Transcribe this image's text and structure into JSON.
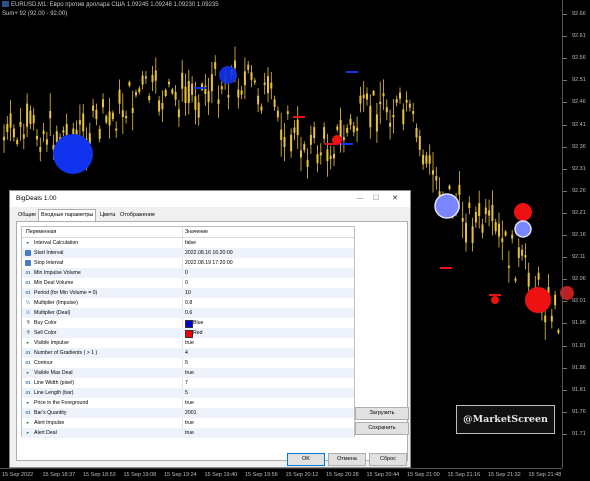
{
  "chart": {
    "header_line1": "EURUSD,M1: Евро против доллара США  1.09245 1.09248 1.09230 1.09235",
    "header_line2": "Sum+ 92 (92.00 - 92.00)",
    "price_labels": [
      "92.66",
      "92.61",
      "92.56",
      "92.51",
      "92.46",
      "92.41",
      "92.36",
      "92.31",
      "92.26",
      "92.21",
      "92.16",
      "92.11",
      "92.06",
      "92.01",
      "91.96",
      "91.91",
      "91.86",
      "91.81",
      "91.76",
      "91.71"
    ],
    "time_labels": [
      "15 Sep 2022",
      "15 Sep 18:37",
      "15 Sep 18:53",
      "15 Sep 19:08",
      "15 Sep 19:24",
      "15 Sep 19:40",
      "15 Sep 19:56",
      "15 Sep 20:12",
      "15 Sep 20:28",
      "15 Sep 20:44",
      "15 Sep 21:00",
      "15 Sep 21:16",
      "15 Sep 21:32",
      "15 Sep 21:48"
    ],
    "candle_color": "#e8c33a",
    "buy_color": "#1133ee",
    "sell_color": "#ee1111",
    "watermark": "@MarketScreen"
  },
  "dialog": {
    "title": "BigDeals 1.00",
    "tabs": [
      "Общие",
      "Входные параметры",
      "Цвета",
      "Отображение"
    ],
    "active_tab": "Входные параметры",
    "col_variable": "Переменная",
    "col_value": "Значение",
    "params": [
      {
        "icon": "flag-icon",
        "name": "Interval Calculation",
        "value": "false"
      },
      {
        "icon": "calendar-icon",
        "name": "Start Interval",
        "value": "2022.08.16 16:20:00"
      },
      {
        "icon": "calendar-icon",
        "name": "Stop Interval",
        "value": "2022.08.19 17:20:00"
      },
      {
        "icon": "number-icon",
        "name": "Min Impulse Volume",
        "value": "0"
      },
      {
        "icon": "number-icon",
        "name": "Min Deal Volume",
        "value": "0"
      },
      {
        "icon": "number-icon",
        "name": "Period (for Min Volume = 0)",
        "value": "10"
      },
      {
        "icon": "fraction-icon",
        "name": "Multiplier (Impulse)",
        "value": "0.8"
      },
      {
        "icon": "fraction-icon",
        "name": "Multiplier (Deal)",
        "value": "0.6"
      },
      {
        "icon": "color-icon",
        "name": "Buy Color",
        "value": "Blue",
        "swatch": "#0000cc"
      },
      {
        "icon": "color-icon",
        "name": "Sell Color",
        "value": "Red",
        "swatch": "#ee0000"
      },
      {
        "icon": "flag-icon",
        "name": "Visible Impulse",
        "value": "true"
      },
      {
        "icon": "number-icon",
        "name": "Number of Gradients ( > 1 )",
        "value": "4"
      },
      {
        "icon": "number-icon",
        "name": "Contour",
        "value": "5"
      },
      {
        "icon": "flag-icon",
        "name": "Visible Max Deal",
        "value": "true"
      },
      {
        "icon": "number-icon",
        "name": "Line Width (pixel)",
        "value": "7"
      },
      {
        "icon": "number-icon",
        "name": "Line Length (bar)",
        "value": "5"
      },
      {
        "icon": "flag-icon",
        "name": "Price in the Foreground",
        "value": "true"
      },
      {
        "icon": "number-icon",
        "name": "Bar's Quantity",
        "value": "2001"
      },
      {
        "icon": "flag-icon",
        "name": "Alert Impulse",
        "value": "true"
      },
      {
        "icon": "flag-icon",
        "name": "Alert Deal",
        "value": "true"
      }
    ],
    "load_label": "Загрузить",
    "save_label": "Сохранить",
    "ok_label": "OK",
    "cancel_label": "Отмена",
    "reset_label": "Сброс"
  }
}
